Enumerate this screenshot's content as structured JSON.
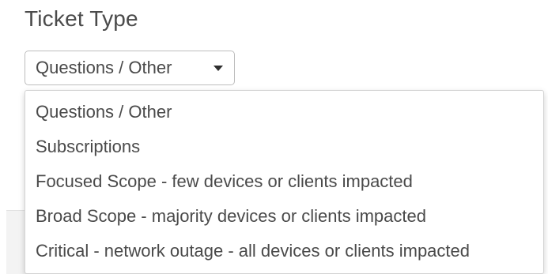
{
  "ticket_type": {
    "title": "Ticket Type",
    "selected": "Questions / Other",
    "caret_icon": "caret-down-icon",
    "options": [
      "Questions / Other",
      "Subscriptions",
      "Focused Scope - few devices or clients impacted",
      "Broad Scope - majority devices or clients impacted",
      "Critical - network outage - all devices or clients impacted"
    ]
  }
}
